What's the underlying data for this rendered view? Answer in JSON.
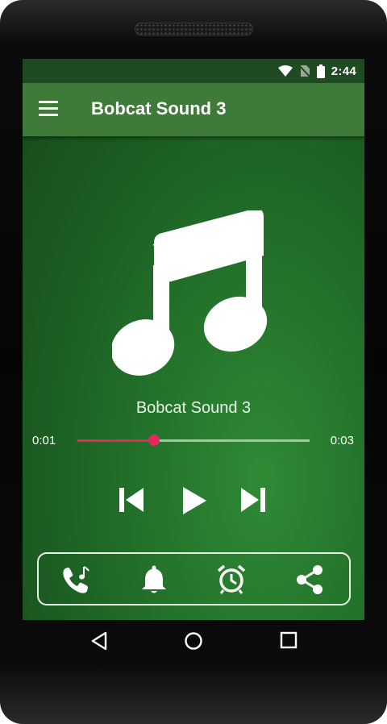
{
  "status_bar": {
    "time": "2:44"
  },
  "app_bar": {
    "title": "Bobcat Sound 3",
    "menu_icon": "hamburger-menu-icon"
  },
  "player": {
    "track_title": "Bobcat Sound 3",
    "artwork_icon": "music-note-icon",
    "current_time": "0:01",
    "duration": "0:03",
    "progress": 0.33,
    "accent_color": "#e32a5d"
  },
  "controls": [
    "skip-previous-icon",
    "play-icon",
    "skip-next-icon"
  ],
  "actions": [
    "ringtone-icon",
    "notification-bell-icon",
    "alarm-clock-icon",
    "share-icon"
  ],
  "nav": [
    "back-icon",
    "home-icon",
    "recents-icon"
  ],
  "colors": {
    "app_bar": "#3e7a38",
    "status_bar": "#1f4a22",
    "background": "#23722a"
  }
}
